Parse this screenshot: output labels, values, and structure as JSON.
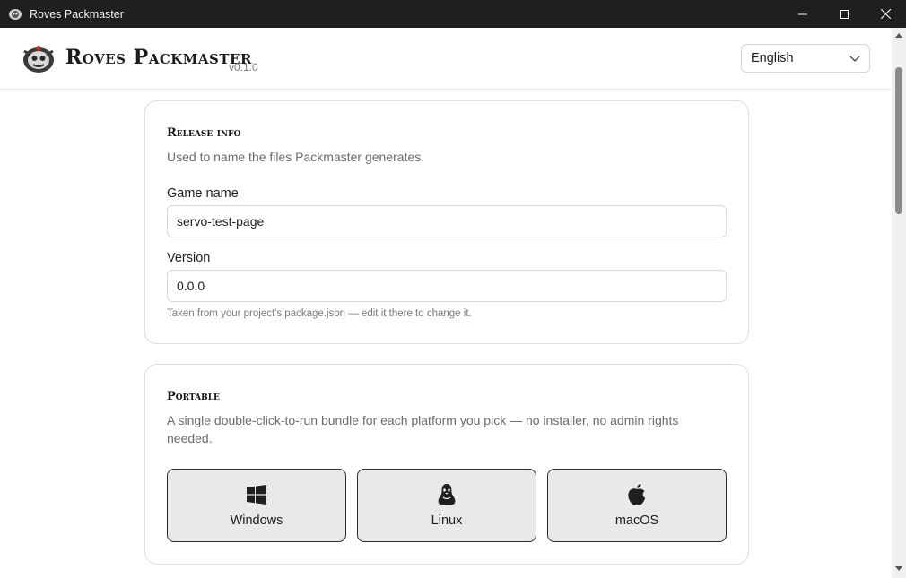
{
  "window": {
    "title": "Roves Packmaster",
    "controls": [
      "minimize-icon",
      "maximize-icon",
      "close-icon"
    ]
  },
  "header": {
    "brand": "Roves Packmaster",
    "version": "v0.1.0",
    "language": {
      "selected": "English"
    }
  },
  "release_info": {
    "title": "Release info",
    "description": "Used to name the files Packmaster generates.",
    "game_name": {
      "label": "Game name",
      "value": "servo-test-page"
    },
    "version": {
      "label": "Version",
      "value": "0.0.0"
    },
    "hint": "Taken from your project's package.json — edit it there to change it."
  },
  "portable": {
    "title": "Portable",
    "description": "A single double-click-to-run bundle for each platform you pick — no installer, no admin rights needed.",
    "platforms": [
      {
        "label": "Windows",
        "icon": "windows-icon"
      },
      {
        "label": "Linux",
        "icon": "linux-icon"
      },
      {
        "label": "macOS",
        "icon": "apple-icon"
      }
    ]
  }
}
